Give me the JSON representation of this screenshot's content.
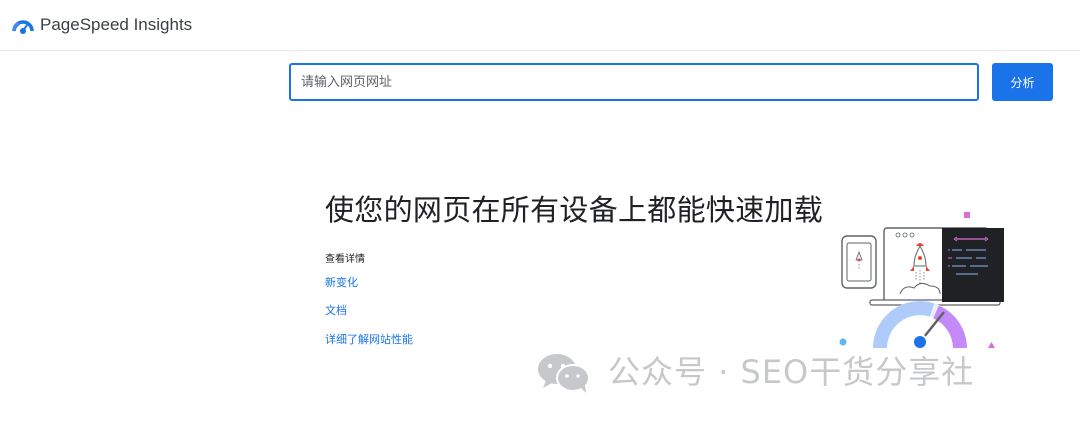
{
  "header": {
    "brand": "PageSpeed Insights",
    "logo_icon": "pagespeed-logo-icon"
  },
  "search": {
    "placeholder": "请输入网页网址",
    "value": "",
    "button_label": "分析"
  },
  "hero": {
    "title": "使您的网页在所有设备上都能快速加载",
    "links_heading": "查看详情",
    "links": [
      {
        "label": "新变化"
      },
      {
        "label": "文档"
      },
      {
        "label": "详细了解网站性能"
      }
    ]
  },
  "illustration": {
    "icon": "rocket-speed-illustration"
  },
  "watermark": {
    "text": "公众号 · SEO干货分享社",
    "icon": "wechat-icon"
  },
  "colors": {
    "accent": "#1a73e8",
    "text": "#202124",
    "watermark": "#c6c8cc"
  }
}
